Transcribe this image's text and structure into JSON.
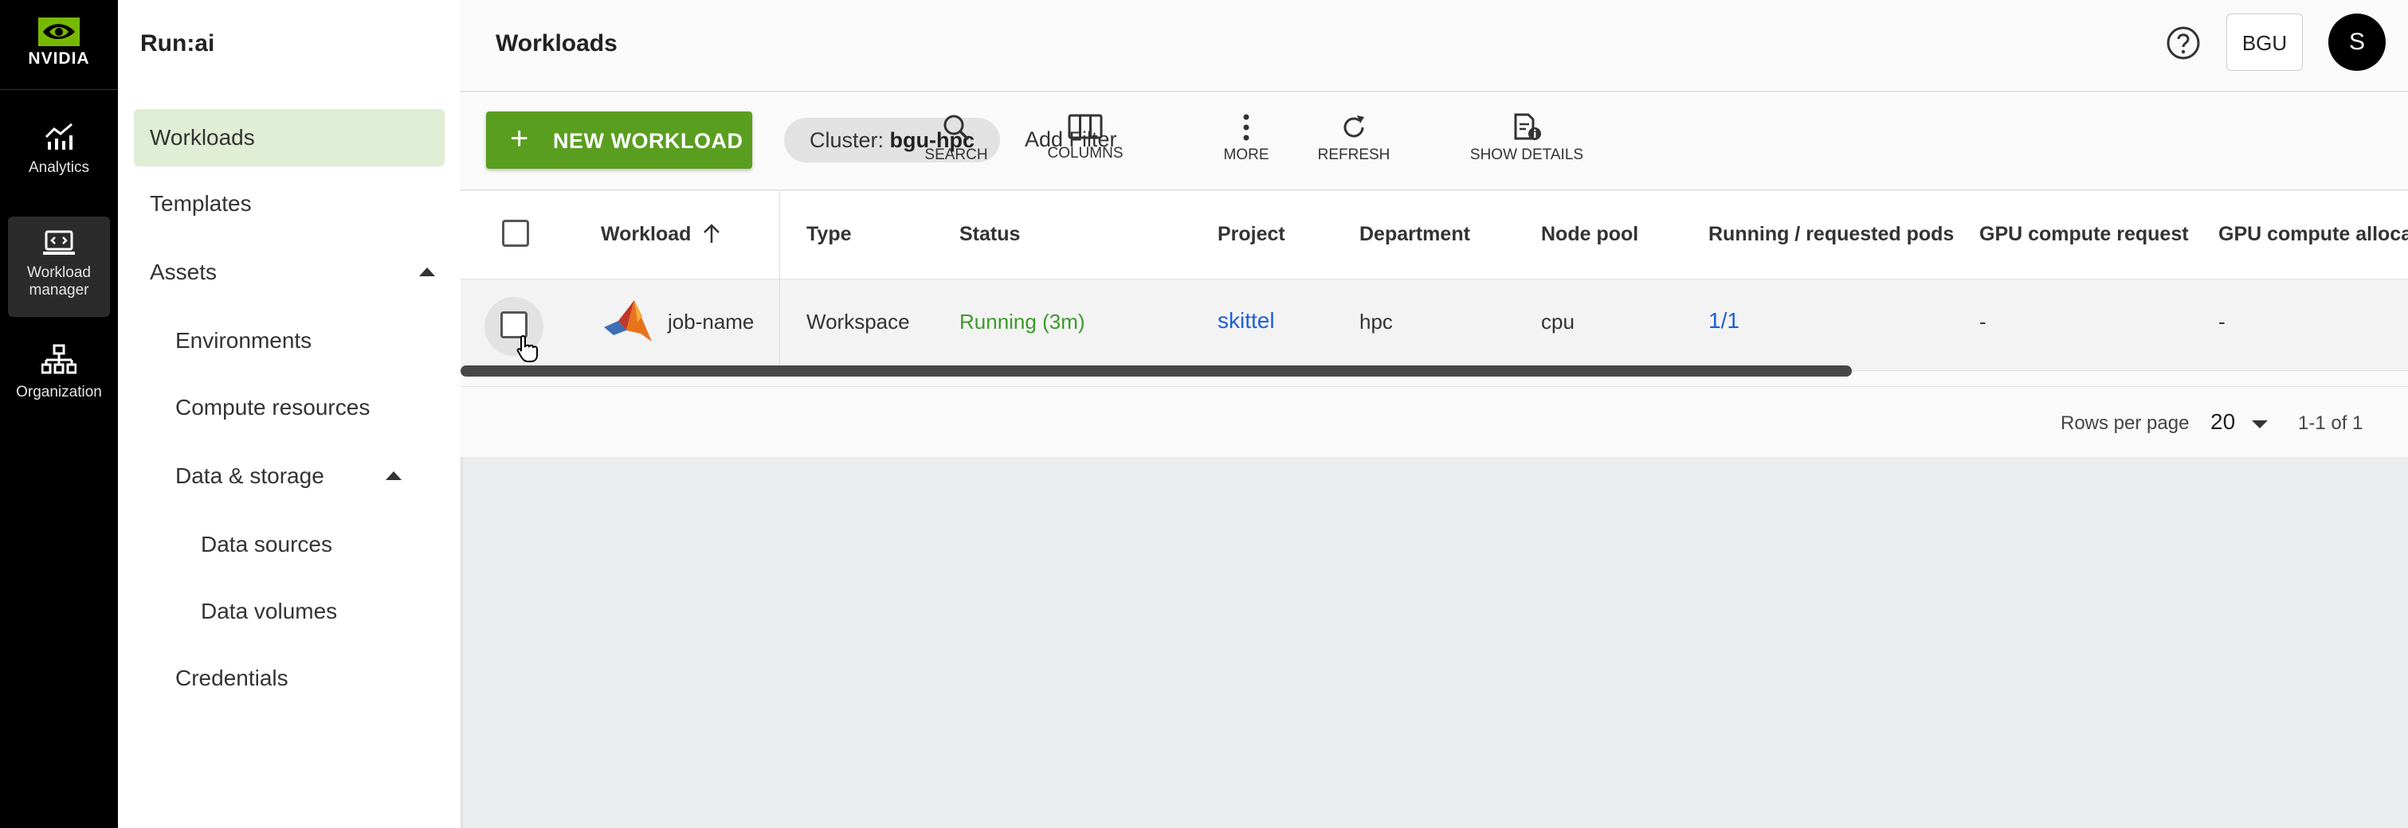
{
  "rail": {
    "brand": "NVIDIA",
    "items": [
      {
        "label": "Analytics",
        "icon": "chart-icon"
      },
      {
        "label_line1": "Workload",
        "label_line2": "manager",
        "icon": "workload-icon"
      },
      {
        "label": "Organization",
        "icon": "org-tree-icon"
      }
    ]
  },
  "sidebar": {
    "title": "Run:ai",
    "items": {
      "workloads": "Workloads",
      "templates": "Templates",
      "assets": "Assets",
      "environments": "Environments",
      "compute_resources": "Compute resources",
      "data_storage": "Data & storage",
      "data_sources": "Data sources",
      "data_volumes": "Data volumes",
      "credentials": "Credentials"
    }
  },
  "header": {
    "title": "Workloads",
    "org_button": "BGU",
    "avatar_initial": "S"
  },
  "toolbar": {
    "new_plus": "+",
    "new_label": "NEW WORKLOAD",
    "cluster_label": "Cluster:",
    "cluster_value": "bgu-hpc",
    "add_filter": "Add Filter",
    "tools": {
      "search": "SEARCH",
      "columns": "COLUMNS",
      "more": "MORE",
      "refresh": "REFRESH",
      "show_details": "SHOW DETAILS"
    }
  },
  "table": {
    "columns": {
      "workload": "Workload",
      "type": "Type",
      "status": "Status",
      "project": "Project",
      "department": "Department",
      "node_pool": "Node pool",
      "pods": "Running / requested pods",
      "gpu_request": "GPU compute request",
      "gpu_allocation": "GPU compute allocatio"
    },
    "rows": [
      {
        "workload": "job-name",
        "type": "Workspace",
        "status": "Running (3m)",
        "project": "skittel",
        "department": "hpc",
        "node_pool": "cpu",
        "pods": "1/1",
        "gpu_request": "-",
        "gpu_allocation": "-"
      }
    ],
    "footer": {
      "rows_per_page_label": "Rows per page",
      "rows_per_page": "20",
      "range": "1-1 of 1"
    }
  },
  "colors": {
    "primary_green": "#5a9e20",
    "active_nav_bg": "#dfeed4",
    "status_running": "#3a9a2a",
    "link_blue": "#1d5fd6"
  }
}
